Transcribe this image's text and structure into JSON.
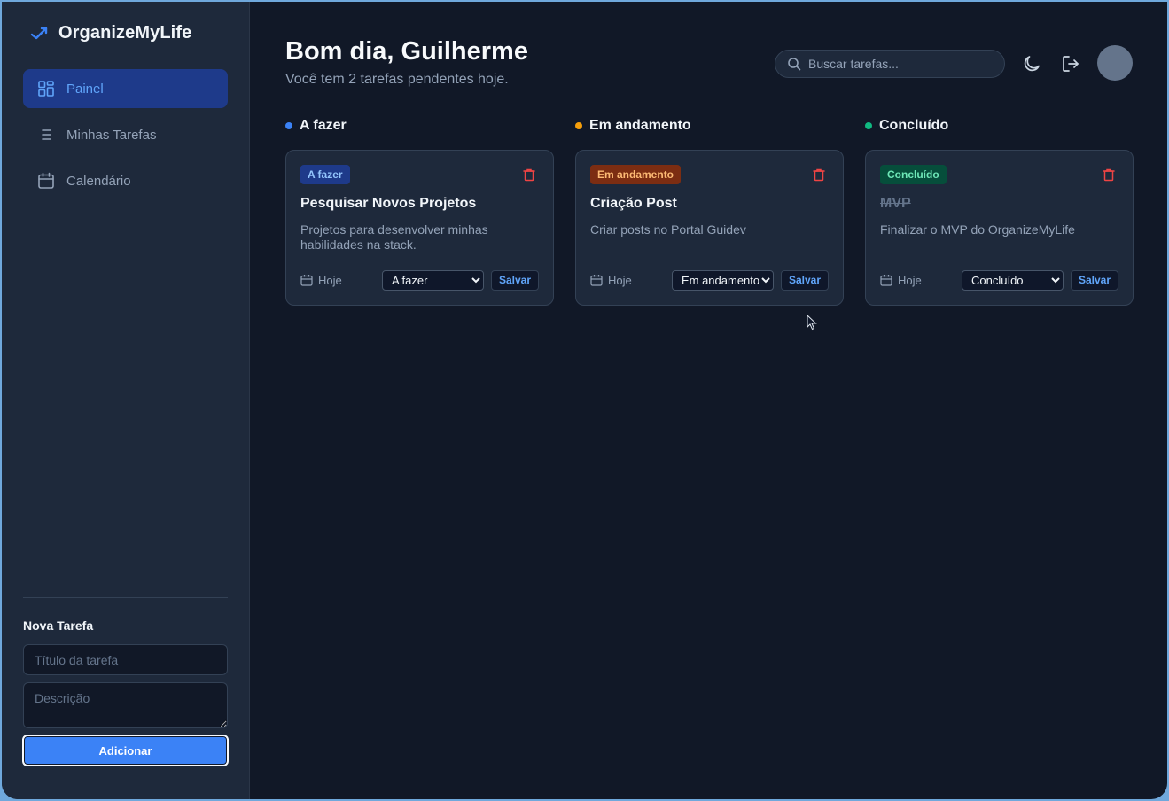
{
  "colors": {
    "accent": "#3b82f6",
    "todo": "#3b82f6",
    "in_progress": "#f59e0b",
    "done": "#10b981",
    "danger": "#ef4444"
  },
  "sidebar": {
    "brand": "OrganizeMyLife",
    "brand_icon": "trending-check-icon",
    "items": [
      {
        "label": "Painel",
        "icon": "dashboard-icon",
        "active": true
      },
      {
        "label": "Minhas Tarefas",
        "icon": "list-icon",
        "active": false
      },
      {
        "label": "Calendário",
        "icon": "calendar-icon",
        "active": false
      }
    ],
    "new_task": {
      "title": "Nova Tarefa",
      "title_placeholder": "Título da tarefa",
      "description_placeholder": "Descrição",
      "add_label": "Adicionar"
    }
  },
  "header": {
    "greeting": "Bom dia, Guilherme",
    "subtitle": "Você tem 2 tarefas pendentes hoje.",
    "search_placeholder": "Buscar tarefas...",
    "icons": [
      "search-icon",
      "moon-icon",
      "logout-icon",
      "avatar"
    ]
  },
  "board": {
    "columns": [
      {
        "title": "A fazer",
        "cards": [
          {
            "badge": "A fazer",
            "title": "Pesquisar Novos Projetos",
            "description": "Projetos para desenvolver minhas habilidades na stack.",
            "date": "Hoje",
            "status": "A fazer",
            "save_label": "Salvar"
          }
        ]
      },
      {
        "title": "Em andamento",
        "cards": [
          {
            "badge": "Em andamento",
            "title": "Criação Post",
            "description": "Criar posts no Portal Guidev",
            "date": "Hoje",
            "status": "Em andamento",
            "save_label": "Salvar"
          }
        ]
      },
      {
        "title": "Concluído",
        "cards": [
          {
            "badge": "Concluído",
            "title": "MVP",
            "description": "Finalizar o MVP do OrganizeMyLife",
            "date": "Hoje",
            "status": "Concluído",
            "save_label": "Salvar"
          }
        ]
      }
    ]
  }
}
